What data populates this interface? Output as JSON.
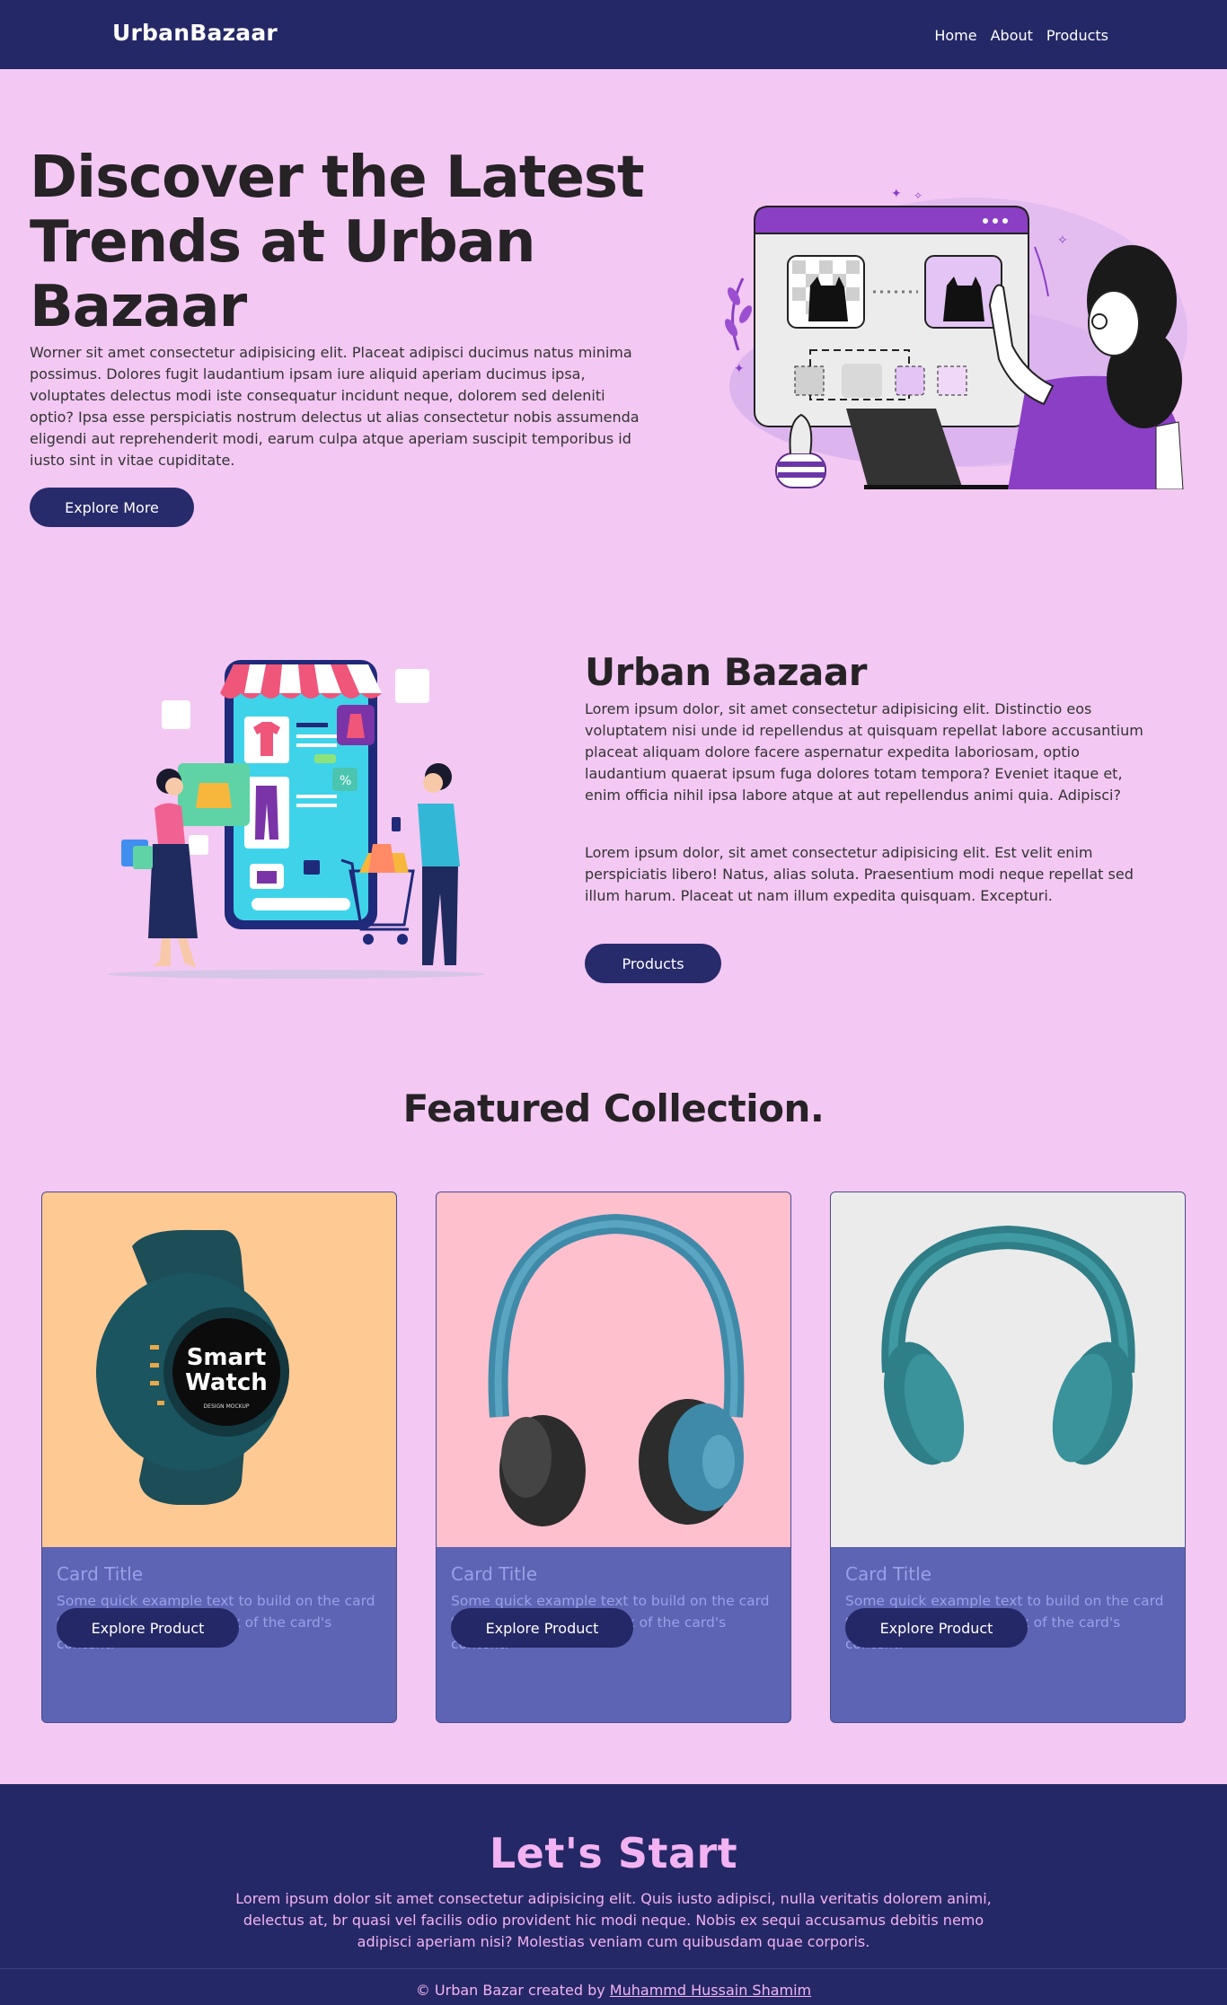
{
  "nav": {
    "brand": "UrbanBazaar",
    "links": [
      "Home",
      "About",
      "Products"
    ]
  },
  "hero": {
    "title": "Discover the Latest Trends at Urban Bazaar",
    "text": "Worner sit amet consectetur adipisicing elit. Placeat adipisci ducimus natus minima possimus. Dolores fugit laudantium ipsam iure aliquid aperiam ducimus ipsa, voluptates delectus modi iste consequatur incidunt neque, dolorem sed deleniti optio? Ipsa esse perspiciatis nostrum delectus ut alias consectetur nobis assumenda eligendi aut reprehenderit modi, earum culpa atque aperiam suscipit temporibus id iusto sint in vitae cupiditate.",
    "button": "Explore More",
    "illustration": "woman-with-laptop-image-editor-illustration"
  },
  "about": {
    "title": "Urban Bazaar",
    "p1": "Lorem ipsum dolor, sit amet consectetur adipisicing elit. Distinctio eos voluptatem nisi unde id repellendus at quisquam repellat labore accusantium placeat aliquam dolore facere aspernatur expedita laboriosam, optio laudantium quaerat ipsum fuga dolores totam tempora? Eveniet itaque et, enim officia nihil ipsa labore atque at aut repellendus animi quia. Adipisci?",
    "p2": "Lorem ipsum dolor, sit amet consectetur adipisicing elit. Est velit enim perspiciatis libero! Natus, alias soluta. Praesentium modi neque repellat sed illum harum. Placeat ut nam illum expedita quisquam. Excepturi.",
    "button": "Products",
    "illustration": "online-shopping-phone-store-illustration"
  },
  "featured": {
    "title": "Featured Collection.",
    "cards": [
      {
        "title": "Card Title",
        "text": "Some quick example text to build on the card title and make up the bulk of the card's content.",
        "button": "Explore Product",
        "image": "smartwatch",
        "bg": "#ffc993",
        "watch_line1": "Smart",
        "watch_line2": "Watch",
        "watch_caption": "DESIGN MOCKUP"
      },
      {
        "title": "Card Title",
        "text": "Some quick example text to build on the card title and make up the bulk of the card's content.",
        "button": "Explore Product",
        "image": "blue-headphones",
        "bg": "#ffc0ce"
      },
      {
        "title": "Card Title",
        "text": "Some quick example text to build on the card title and make up the bulk of the card's content.",
        "button": "Explore Product",
        "image": "teal-headphones",
        "bg": "#ebebeb"
      }
    ]
  },
  "footer": {
    "title": "Let's Start",
    "text": "Lorem ipsum dolor sit amet consectetur adipisicing elit. Quis iusto adipisci, nulla veritatis dolorem animi, delectus at, br quasi vel facilis odio provident hic modi neque. Nobis ex sequi accusamus debitis nemo adipisci aperiam nisi? Molestias veniam cum quibusdam quae corporis.",
    "copyright_prefix": "© Urban Bazar created by ",
    "author": "Muhammd Hussain Shamim"
  },
  "colors": {
    "page_bg": "#f3c8f3",
    "navy": "#252866",
    "card_body": "#5d64b4",
    "pink_text": "#f3b3f2"
  }
}
